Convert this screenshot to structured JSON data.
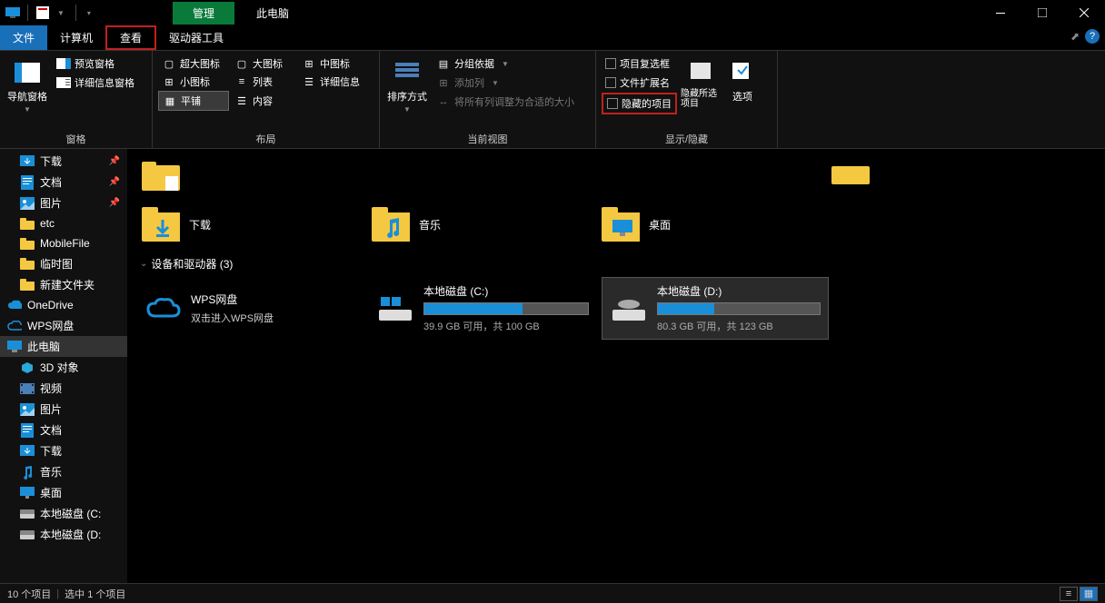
{
  "titlebar": {
    "contextual_tab": "管理",
    "title": "此电脑"
  },
  "tabs": {
    "file": "文件",
    "computer": "计算机",
    "view": "查看",
    "drive_tools": "驱动器工具"
  },
  "ribbon": {
    "panes": {
      "nav_pane": "导航窗格",
      "preview_pane": "预览窗格",
      "details_pane": "详细信息窗格",
      "label": "窗格"
    },
    "layout": {
      "extra_large": "超大图标",
      "large": "大图标",
      "medium": "中图标",
      "small": "小图标",
      "list": "列表",
      "details": "详细信息",
      "tiles": "平铺",
      "content": "内容",
      "label": "布局"
    },
    "current": {
      "sort_by": "排序方式",
      "group_by": "分组依据",
      "add_columns": "添加列",
      "size_all": "将所有列调整为合适的大小",
      "label": "当前视图"
    },
    "showhide": {
      "checkboxes": "项目复选框",
      "extensions": "文件扩展名",
      "hidden_items": "隐藏的项目",
      "hide_selected": "隐藏所选项目",
      "options": "选项",
      "label": "显示/隐藏"
    }
  },
  "sidebar": {
    "items": [
      {
        "label": "下载",
        "icon": "download",
        "pinned": true
      },
      {
        "label": "文档",
        "icon": "document",
        "pinned": true
      },
      {
        "label": "图片",
        "icon": "picture",
        "pinned": true
      },
      {
        "label": "etc",
        "icon": "folder"
      },
      {
        "label": "MobileFile",
        "icon": "folder"
      },
      {
        "label": "临时图",
        "icon": "folder"
      },
      {
        "label": "新建文件夹",
        "icon": "folder"
      },
      {
        "label": "OneDrive",
        "icon": "onedrive",
        "top": true
      },
      {
        "label": "WPS网盘",
        "icon": "wps",
        "top": true
      },
      {
        "label": "此电脑",
        "icon": "pc",
        "top": true,
        "active": true
      },
      {
        "label": "3D 对象",
        "icon": "3d"
      },
      {
        "label": "视频",
        "icon": "video"
      },
      {
        "label": "图片",
        "icon": "picture"
      },
      {
        "label": "文档",
        "icon": "document"
      },
      {
        "label": "下载",
        "icon": "download"
      },
      {
        "label": "音乐",
        "icon": "music"
      },
      {
        "label": "桌面",
        "icon": "desktop"
      },
      {
        "label": "本地磁盘 (C:",
        "icon": "drive"
      },
      {
        "label": "本地磁盘 (D:",
        "icon": "drive"
      }
    ]
  },
  "content": {
    "folders_top": [
      {
        "label": "",
        "icon": "folder-doc"
      }
    ],
    "folders": [
      {
        "label": "下载",
        "icon": "download-folder"
      },
      {
        "label": "音乐",
        "icon": "music-folder"
      },
      {
        "label": "桌面",
        "icon": "desktop-folder"
      }
    ],
    "devices_header": "设备和驱动器 (3)",
    "devices": {
      "wps": {
        "name": "WPS网盘",
        "sub": "双击进入WPS网盘"
      },
      "c": {
        "name": "本地磁盘 (C:)",
        "space": "39.9 GB 可用，共 100 GB",
        "fill": 60
      },
      "d": {
        "name": "本地磁盘 (D:)",
        "space": "80.3 GB 可用，共 123 GB",
        "fill": 35,
        "selected": true
      }
    }
  },
  "statusbar": {
    "count": "10 个项目",
    "selected": "选中 1 个项目"
  }
}
